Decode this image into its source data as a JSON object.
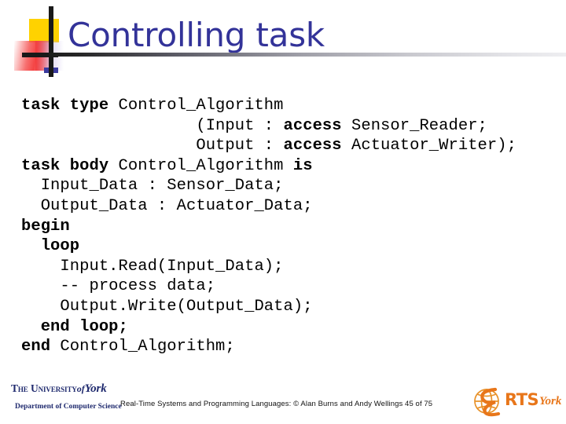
{
  "slide": {
    "title": "Controlling task",
    "title_color": "#333399",
    "background_color": "#ffffff"
  },
  "decoration": {
    "yellow_color": "#ffd200",
    "red_color": "#f43a3a",
    "blue_color": "#3b3b9e",
    "bar_color": "#191919"
  },
  "code": {
    "language": "Ada",
    "lines": [
      [
        {
          "t": "task type ",
          "b": true
        },
        {
          "t": "Control_Algorithm",
          "b": false
        }
      ],
      [
        {
          "t": "                  (Input : ",
          "b": false
        },
        {
          "t": "access ",
          "b": true
        },
        {
          "t": "Sensor_Reader;",
          "b": false
        }
      ],
      [
        {
          "t": "                  Output : ",
          "b": false
        },
        {
          "t": "access ",
          "b": true
        },
        {
          "t": "Actuator_Writer);",
          "b": false
        }
      ],
      [
        {
          "t": "task body ",
          "b": true
        },
        {
          "t": "Control_Algorithm ",
          "b": false
        },
        {
          "t": "is",
          "b": true
        }
      ],
      [
        {
          "t": "  Input_Data : Sensor_Data;",
          "b": false
        }
      ],
      [
        {
          "t": "  Output_Data : Actuator_Data;",
          "b": false
        }
      ],
      [
        {
          "t": "begin",
          "b": true
        }
      ],
      [
        {
          "t": "  loop",
          "b": true
        }
      ],
      [
        {
          "t": "    Input.Read(Input_Data);",
          "b": false
        }
      ],
      [
        {
          "t": "    -- process data;",
          "b": false
        }
      ],
      [
        {
          "t": "    Output.Write(Output_Data);",
          "b": false
        }
      ],
      [
        {
          "t": "  end loop;",
          "b": true
        }
      ],
      [
        {
          "t": "end ",
          "b": true
        },
        {
          "t": "Control_Algorithm;",
          "b": false
        }
      ]
    ]
  },
  "footer": {
    "york_logo": {
      "line1_prefix": "The University",
      "line1_of": "of",
      "line1_name": "York",
      "line2": "Department of Computer Science",
      "color": "#1f2a6e"
    },
    "credit": "Real-Time Systems and Programming Languages: © Alan Burns and Andy Wellings 45 of 75",
    "rts_logo": {
      "text": "RTS",
      "script": "York",
      "color": "#e8761a"
    }
  }
}
